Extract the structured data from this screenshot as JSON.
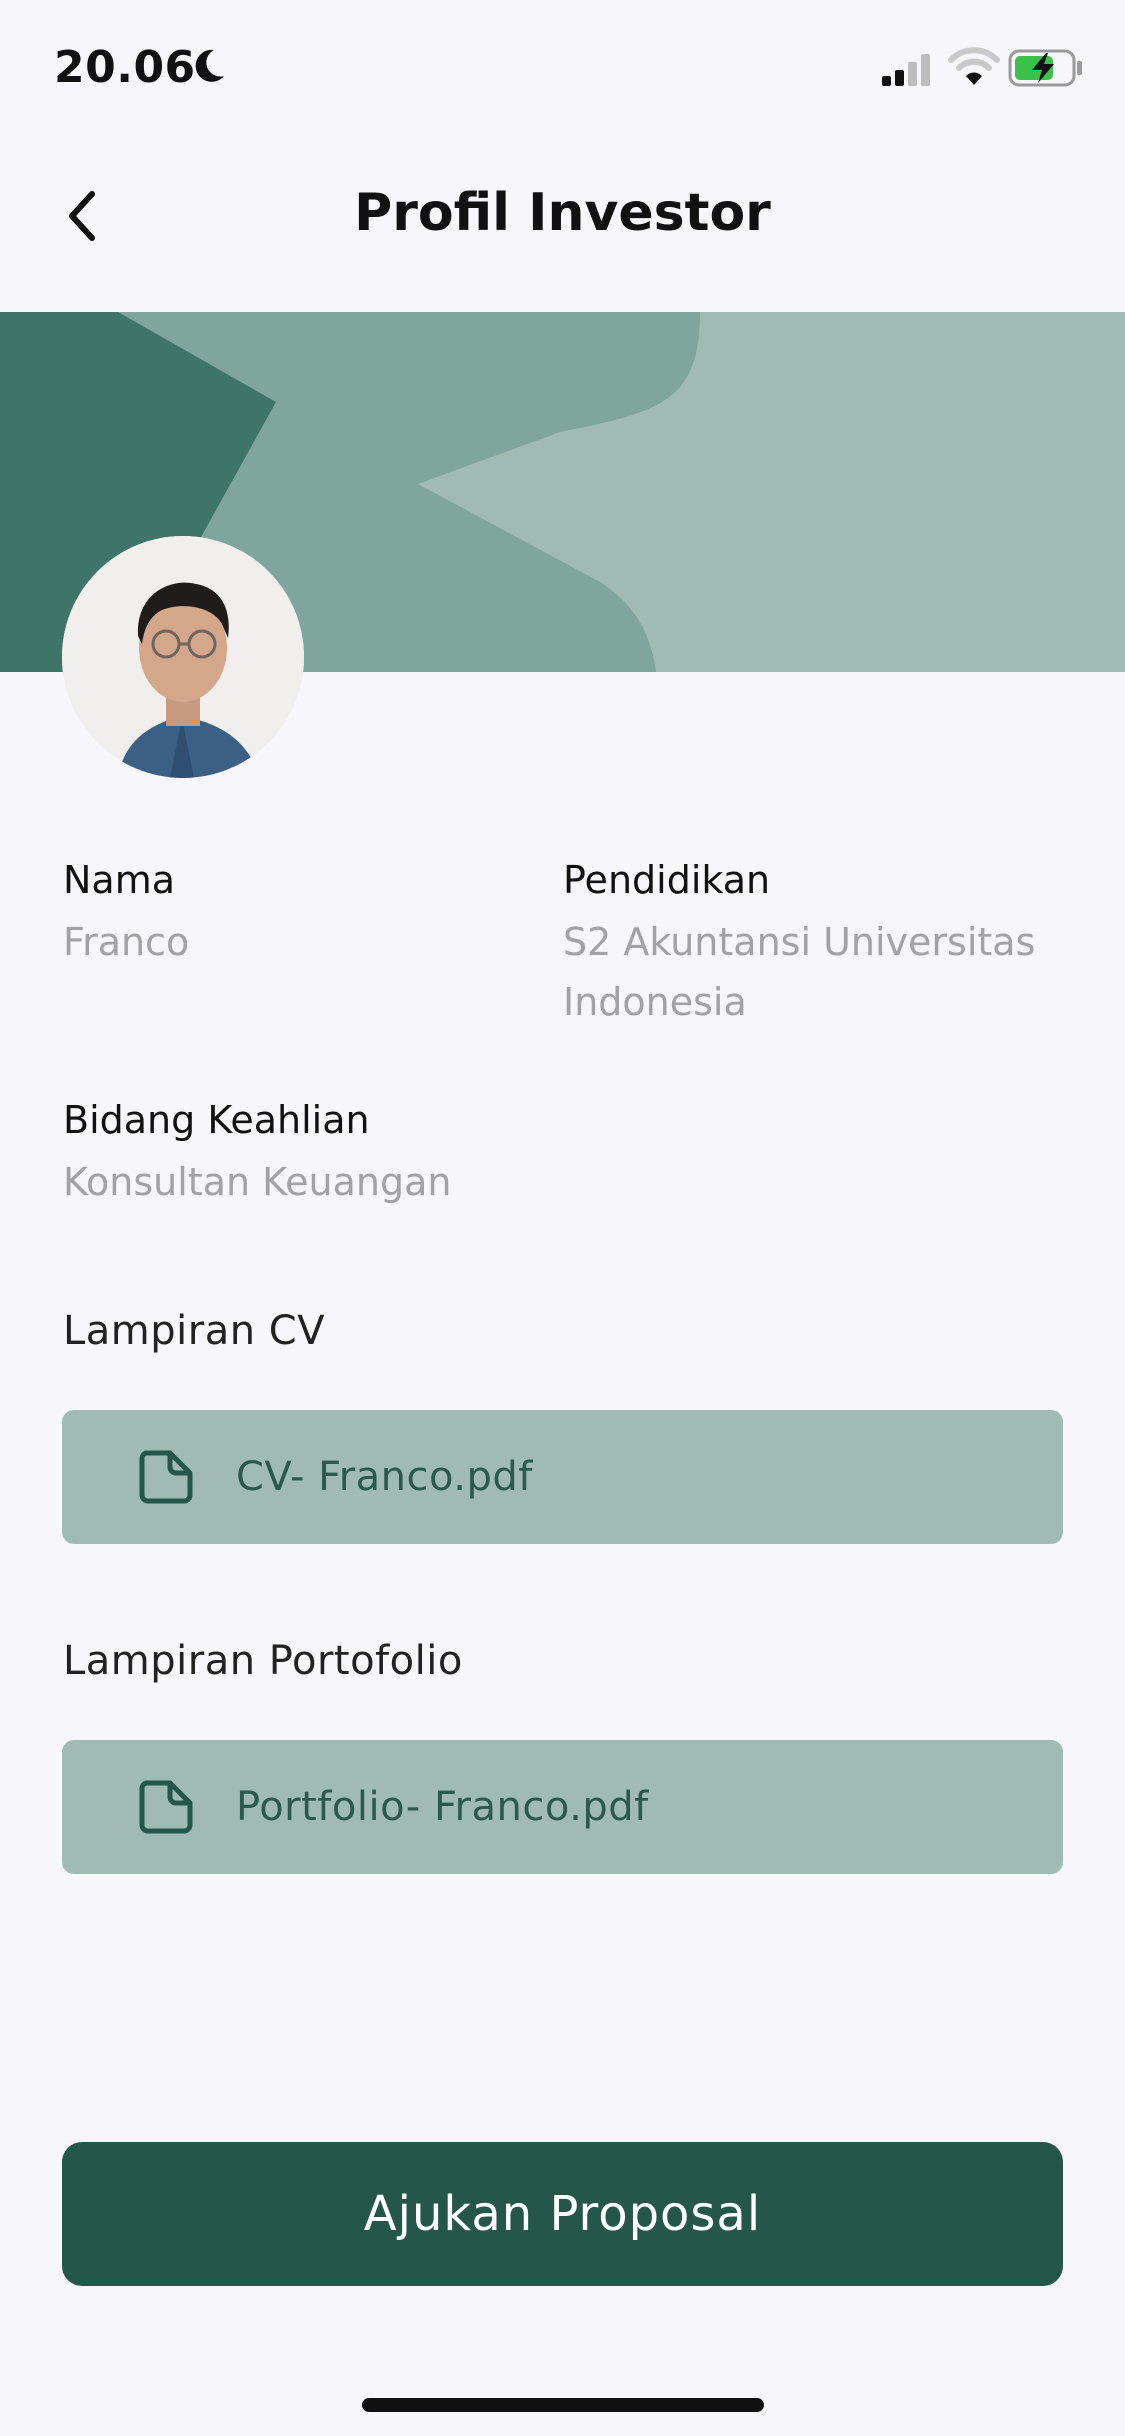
{
  "status_bar": {
    "time": "20.06",
    "icons": [
      "moon-icon",
      "signal-icon",
      "wifi-icon",
      "battery-charging-icon"
    ]
  },
  "header": {
    "title": "Profil Investor",
    "back_icon": "chevron-left-icon"
  },
  "profile": {
    "avatar": "avatar-photo",
    "fields": {
      "name": {
        "label": "Nama",
        "value": "Franco"
      },
      "education": {
        "label": "Pendidikan",
        "value_line1": "S2 Akuntansi Universitas",
        "value_line2": "Indonesia"
      },
      "expertise": {
        "label": "Bidang Keahlian",
        "value": "Konsultan Keuangan"
      }
    }
  },
  "attachments": {
    "cv": {
      "label": "Lampiran CV",
      "file": "CV- Franco.pdf",
      "icon": "file-icon"
    },
    "portfolio": {
      "label": "Lampiran Portofolio",
      "file": "Portfolio- Franco.pdf",
      "icon": "file-icon"
    }
  },
  "actions": {
    "submit_label": "Ajukan Proposal"
  },
  "colors": {
    "background": "#f7f7fb",
    "banner_dark": "#3f7568",
    "banner_mid": "#7fa59c",
    "banner_light": "#9fbbb4",
    "file_card": "#9fbbb4",
    "primary": "#24574a"
  }
}
